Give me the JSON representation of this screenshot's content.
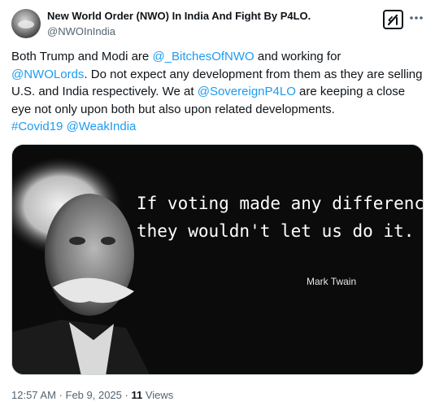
{
  "author": {
    "name": "New World Order (NWO) In India And Fight By P4LO.",
    "handle": "@NWOInIndia"
  },
  "tweet": {
    "t1": "Both Trump and Modi are ",
    "m1": "@_BitchesOfNWO",
    "t2": " and working for ",
    "m2": "@NWOLords",
    "t3": ". Do not expect any development from them as they are selling U.S. and India respectively. We at ",
    "m3": "@SovereignP4LO",
    "t4": " are keeping a close eye not only upon both but also upon related developments.",
    "h1": "#Covid19",
    "m4": "@WeakIndia"
  },
  "media": {
    "quote_line1": "If voting made any difference",
    "quote_line2": "they wouldn't let us do it.",
    "attribution": "Mark Twain"
  },
  "meta": {
    "time": "12:57 AM",
    "sep1": " · ",
    "date": "Feb 9, 2025",
    "sep2": " · ",
    "views_count": "11",
    "views_label": " Views"
  },
  "colors": {
    "link": "#1d9bf0",
    "secondary_text": "#536471",
    "primary_text": "#0f1419",
    "media_background": "#0b0b0b"
  },
  "icons": {
    "grok": "grok-icon",
    "more": "more-icon"
  }
}
